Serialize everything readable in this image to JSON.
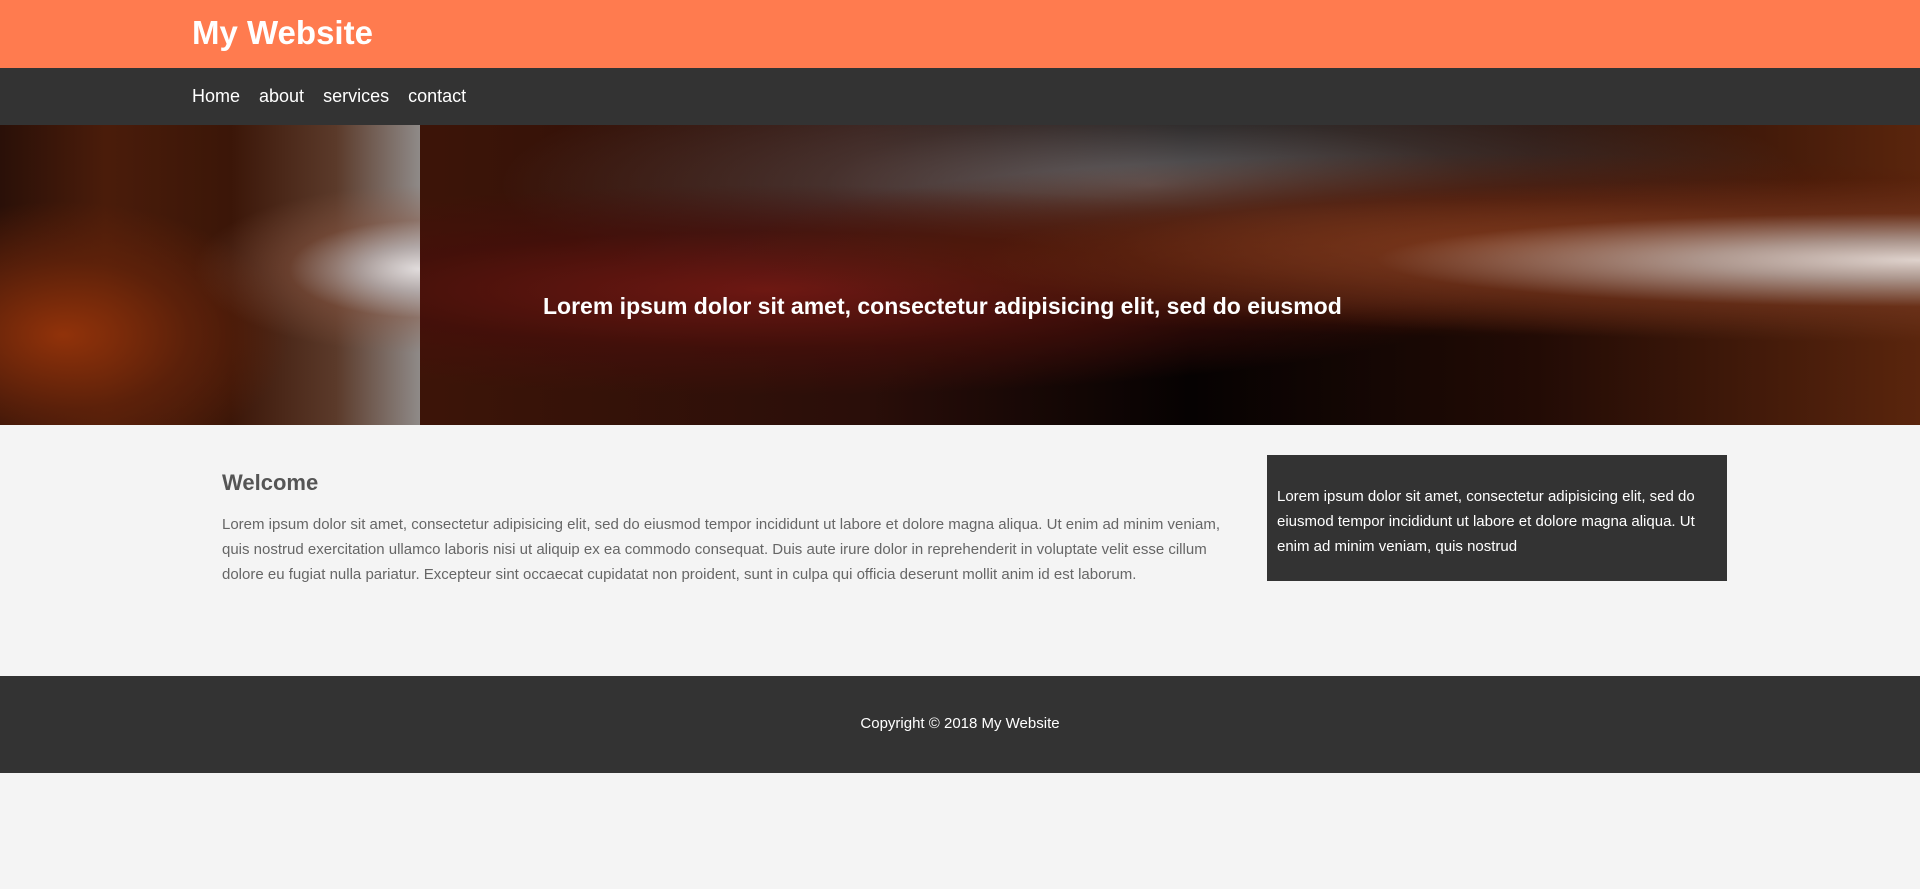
{
  "header": {
    "title": "My Website"
  },
  "nav": {
    "items": [
      {
        "label": "Home"
      },
      {
        "label": "about"
      },
      {
        "label": "services"
      },
      {
        "label": "contact"
      }
    ]
  },
  "hero": {
    "title": "Lorem ipsum dolor sit amet, consectetur adipisicing elit, sed do eiusmod"
  },
  "main": {
    "heading": "Welcome",
    "body": "Lorem ipsum dolor sit amet, consectetur adipisicing elit, sed do eiusmod tempor incididunt ut labore et dolore magna aliqua. Ut enim ad minim veniam, quis nostrud exercitation ullamco laboris nisi ut aliquip ex ea commodo consequat. Duis aute irure dolor in reprehenderit in voluptate velit esse cillum dolore eu fugiat nulla pariatur. Excepteur sint occaecat cupidatat non proident, sunt in culpa qui officia deserunt mollit anim id est laborum."
  },
  "sidebar": {
    "text": "Lorem ipsum dolor sit amet, consectetur adipisicing elit, sed do eiusmod tempor incididunt ut labore et dolore magna aliqua. Ut enim ad minim veniam, quis nostrud"
  },
  "footer": {
    "copyright": "Copyright © 2018 My Website"
  },
  "colors": {
    "header_bg": "#ff7b4f",
    "nav_bg": "#333333",
    "page_bg": "#f4f4f4",
    "footer_bg": "#333333"
  }
}
